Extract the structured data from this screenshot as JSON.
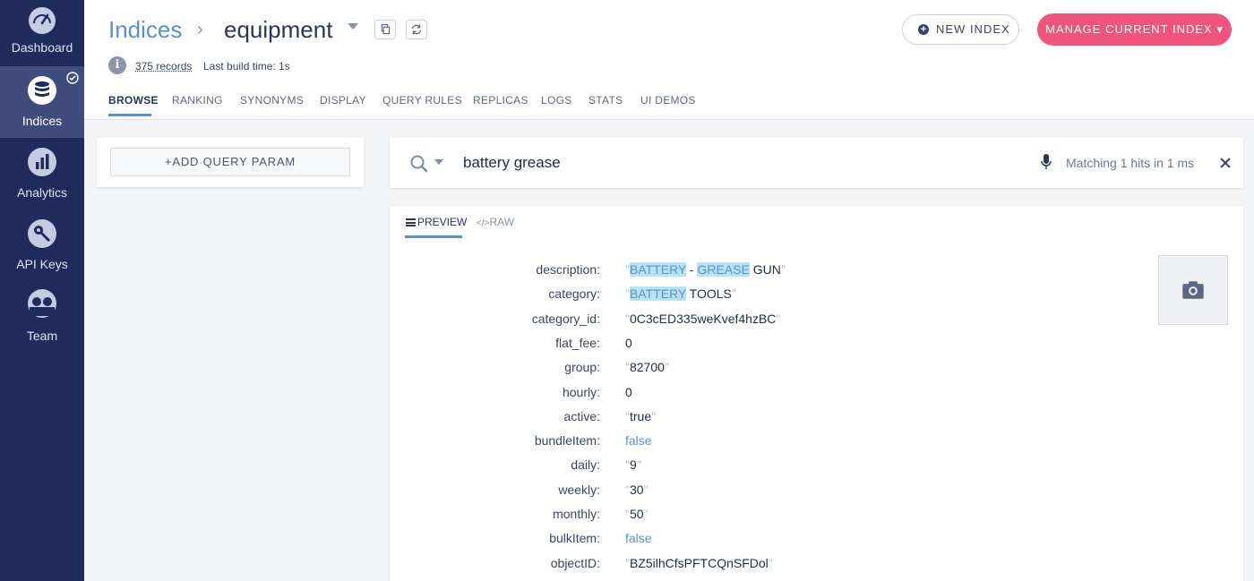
{
  "sidebar": {
    "items": [
      {
        "label": "Dashboard",
        "icon": "gauge-icon",
        "active": false
      },
      {
        "label": "Indices",
        "icon": "database-icon",
        "active": true
      },
      {
        "label": "Analytics",
        "icon": "bar-chart-icon",
        "active": false
      },
      {
        "label": "API Keys",
        "icon": "key-icon",
        "active": false
      },
      {
        "label": "Team",
        "icon": "team-icon",
        "active": false
      }
    ]
  },
  "header": {
    "breadcrumb_root": "Indices",
    "breadcrumb_separator": "›",
    "index_name": "equipment",
    "records": "375 records",
    "build_time": "Last build time: 1s",
    "new_index_label": "NEW INDEX",
    "manage_label": "MANAGE CURRENT INDEX ▾",
    "tabs": [
      {
        "label": "BROWSE",
        "active": true
      },
      {
        "label": "RANKING"
      },
      {
        "label": "SYNONYMS"
      },
      {
        "label": "DISPLAY"
      },
      {
        "label": "QUERY RULES"
      },
      {
        "label": "REPLICAS"
      },
      {
        "label": "LOGS"
      },
      {
        "label": "STATS"
      },
      {
        "label": "UI DEMOS"
      }
    ]
  },
  "left_panel": {
    "add_query_param_label": "+ADD QUERY PARAM"
  },
  "search": {
    "query": "battery grease",
    "matching_text": "Matching 1 hits in 1 ms"
  },
  "results": {
    "tab_preview": "PREVIEW",
    "tab_raw": "RAW",
    "attributes": [
      {
        "key": "description:",
        "segments": [
          {
            "t": "\"",
            "c": "q"
          },
          {
            "t": "BATTERY",
            "c": "hl"
          },
          {
            "t": " - ",
            "c": ""
          },
          {
            "t": "GREASE",
            "c": "hl"
          },
          {
            "t": " GUN",
            "c": ""
          },
          {
            "t": "\"",
            "c": "q"
          }
        ]
      },
      {
        "key": "category:",
        "segments": [
          {
            "t": "\"",
            "c": "q"
          },
          {
            "t": "BATTERY",
            "c": "hl"
          },
          {
            "t": " TOOLS",
            "c": ""
          },
          {
            "t": "\"",
            "c": "q"
          }
        ]
      },
      {
        "key": "category_id:",
        "segments": [
          {
            "t": "\"",
            "c": "q"
          },
          {
            "t": "0C3cED335weKvef4hzBC",
            "c": ""
          },
          {
            "t": "\"",
            "c": "q"
          }
        ]
      },
      {
        "key": "flat_fee:",
        "segments": [
          {
            "t": "0",
            "c": ""
          }
        ]
      },
      {
        "key": "group:",
        "segments": [
          {
            "t": "\"",
            "c": "q"
          },
          {
            "t": "82700",
            "c": ""
          },
          {
            "t": "\"",
            "c": "q"
          }
        ]
      },
      {
        "key": "hourly:",
        "segments": [
          {
            "t": "0",
            "c": ""
          }
        ]
      },
      {
        "key": "active:",
        "segments": [
          {
            "t": "\"",
            "c": "q"
          },
          {
            "t": "true",
            "c": ""
          },
          {
            "t": "\"",
            "c": "q"
          }
        ]
      },
      {
        "key": "bundleItem:",
        "segments": [
          {
            "t": "false",
            "c": "bool"
          }
        ]
      },
      {
        "key": "daily:",
        "segments": [
          {
            "t": "\"",
            "c": "q"
          },
          {
            "t": "9",
            "c": ""
          },
          {
            "t": "\"",
            "c": "q"
          }
        ]
      },
      {
        "key": "weekly:",
        "segments": [
          {
            "t": "\"",
            "c": "q"
          },
          {
            "t": "30",
            "c": ""
          },
          {
            "t": "\"",
            "c": "q"
          }
        ]
      },
      {
        "key": "monthly:",
        "segments": [
          {
            "t": "\"",
            "c": "q"
          },
          {
            "t": "50",
            "c": ""
          },
          {
            "t": "\"",
            "c": "q"
          }
        ]
      },
      {
        "key": "bulkItem:",
        "segments": [
          {
            "t": "false",
            "c": "bool"
          }
        ]
      },
      {
        "key": "objectID:",
        "segments": [
          {
            "t": "\"",
            "c": "q"
          },
          {
            "t": "BZ5ilhCfsPFTCQnSFDol",
            "c": ""
          },
          {
            "t": "\"",
            "c": "q"
          }
        ]
      }
    ],
    "image_placeholder_icon": "camera-icon"
  },
  "colors": {
    "sidebar_bg": "#1f2b5b",
    "accent": "#5b8fd1",
    "primary_button": "#f0537b",
    "highlight": "#b8e3f3"
  }
}
